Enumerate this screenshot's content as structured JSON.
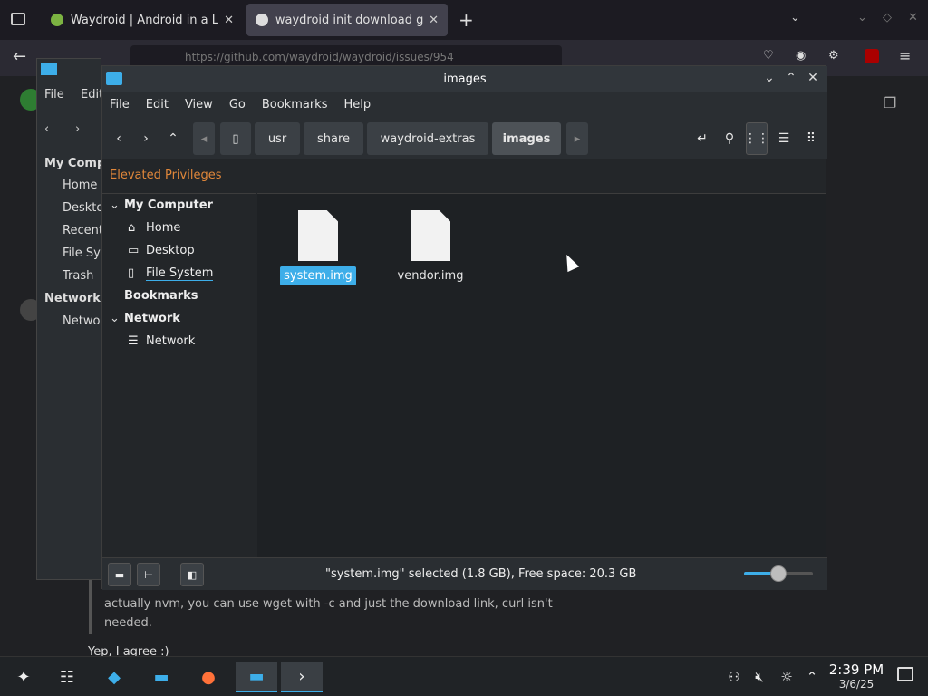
{
  "browser": {
    "tabs": [
      {
        "title": "Waydroid | Android in a Li"
      },
      {
        "title": "waydroid init download ge"
      }
    ],
    "new_tab": "+",
    "url": "https://github.com/waydroid/waydroid/issues/954"
  },
  "webpage": {
    "comment": "actually nvm, you can use wget with -c and just the download link, curl isn't needed.",
    "reply": "Yep, I agree :)"
  },
  "back_window": {
    "menu": [
      "File",
      "Edit"
    ],
    "sections": [
      "My Computer",
      "Network"
    ],
    "items": [
      "Home",
      "Desktop",
      "Recent",
      "File System",
      "Trash",
      "Network"
    ]
  },
  "window": {
    "title": "images",
    "menu": [
      "File",
      "Edit",
      "View",
      "Go",
      "Bookmarks",
      "Help"
    ],
    "breadcrumbs": [
      "usr",
      "share",
      "waydroid-extras",
      "images"
    ],
    "elevated": "Elevated Privileges",
    "sidebar": {
      "my_computer": "My Computer",
      "home": "Home",
      "desktop": "Desktop",
      "filesystem": "File System",
      "bookmarks": "Bookmarks",
      "network_section": "Network",
      "network": "Network"
    },
    "files": [
      {
        "name": "system.img",
        "selected": true
      },
      {
        "name": "vendor.img",
        "selected": false
      }
    ],
    "status": "\"system.img\" selected (1.8 GB), Free space: 20.3 GB",
    "zoom_fraction": 0.5
  },
  "taskbar": {
    "time": "2:39 PM",
    "date": "3/6/25"
  },
  "colors": {
    "accent": "#3daee9",
    "elevated": "#e0873a"
  }
}
